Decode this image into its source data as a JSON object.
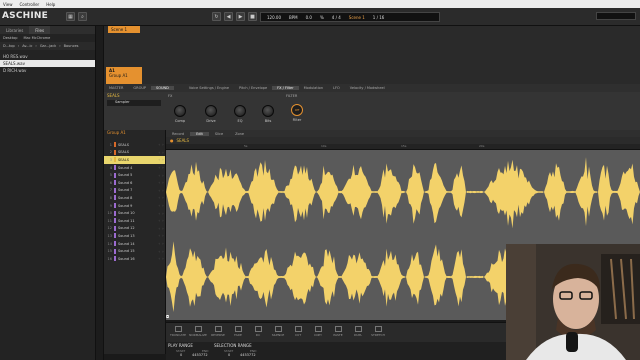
{
  "menubar": [
    "View",
    "Controller",
    "Help"
  ],
  "app_title": "ASCHINE",
  "transport": {
    "tempo": "120.00",
    "tempo_unit": "BPM",
    "swing": "0.0",
    "swing_unit": "%",
    "signature": "4 / 4",
    "scene": "Scene 1",
    "position": "1 / 16"
  },
  "browser": {
    "tabs": [
      "Libraries",
      "Files"
    ],
    "path_shortcuts": [
      "Desktop",
      "Mac McChrome"
    ],
    "path": [
      "D...top",
      "Av...ic",
      "Gar...jack",
      "Bounces"
    ],
    "files": [
      "HO RES.wav",
      "SEALS.wav",
      "D RICH.wav"
    ],
    "selected_index": 1
  },
  "arranger": {
    "scene_label": "Scene 1",
    "group_label": "A1",
    "group_name": "Group A1"
  },
  "plugin": {
    "strip_tabs": [
      "MASTER",
      "GROUP",
      "SOUND"
    ],
    "strip_active": "SOUND",
    "pages": [
      "Voice Settings / Engine",
      "Pitch / Envelope",
      "FX / Filter",
      "Modulation",
      "LFO",
      "Velocity / Modwheel"
    ],
    "active_page": "FX / Filter",
    "sound_name": "SEALS",
    "plugin_name": "Sampler",
    "sections": [
      "FX",
      "FILTER"
    ],
    "knobs": [
      "Comp",
      "Drive",
      "EQ",
      "Bits"
    ],
    "filter_value": "Off",
    "filter_label": "Filter"
  },
  "sounds": {
    "group_name": "Group A1",
    "items": [
      {
        "n": "1",
        "name": "SEALS",
        "color": "#d86a2a"
      },
      {
        "n": "2",
        "name": "SEALS",
        "color": "#d86a2a"
      },
      {
        "n": "3",
        "name": "SEALS",
        "color": "#e5b840"
      },
      {
        "n": "4",
        "name": "Sound 4",
        "color": "#9c6bd0"
      },
      {
        "n": "5",
        "name": "Sound 5",
        "color": "#9c6bd0"
      },
      {
        "n": "6",
        "name": "Sound 6",
        "color": "#9c6bd0"
      },
      {
        "n": "7",
        "name": "Sound 7",
        "color": "#9c6bd0"
      },
      {
        "n": "8",
        "name": "Sound 8",
        "color": "#9c6bd0"
      },
      {
        "n": "9",
        "name": "Sound 9",
        "color": "#9c6bd0"
      },
      {
        "n": "10",
        "name": "Sound 10",
        "color": "#9c6bd0"
      },
      {
        "n": "11",
        "name": "Sound 11",
        "color": "#9c6bd0"
      },
      {
        "n": "12",
        "name": "Sound 12",
        "color": "#9c6bd0"
      },
      {
        "n": "13",
        "name": "Sound 13",
        "color": "#9c6bd0"
      },
      {
        "n": "14",
        "name": "Sound 14",
        "color": "#9c6bd0"
      },
      {
        "n": "15",
        "name": "Sound 15",
        "color": "#9c6bd0"
      },
      {
        "n": "16",
        "name": "Sound 16",
        "color": "#9c6bd0"
      }
    ],
    "selected_index": 2
  },
  "editor": {
    "tabs": [
      "Record",
      "Edit",
      "Slice",
      "Zone"
    ],
    "active_tab": "Edit",
    "sample_name": "SEALS",
    "ruler_marks": [
      "5s",
      "10s",
      "15s",
      "20s"
    ],
    "waveform_color": "#f3d26a"
  },
  "bottom_tools": [
    "TRUNCATE",
    "NORMALIZE",
    "REVERSE",
    "FADE",
    "DC",
    "SILENCE",
    "CUT",
    "COPY",
    "PASTE",
    "DUPL",
    "STRETCH"
  ],
  "ranges": {
    "play_range": "PLAY RANGE",
    "selection_range": "SELECTION RANGE",
    "start_label": "START",
    "end_label": "END",
    "play_start": "0",
    "play_end": "4453772",
    "sel_start": "0",
    "sel_end": "4453772"
  },
  "colors": {
    "accent": "#e5912f",
    "waveform": "#f3d26a",
    "selected_row": "#e9d66d"
  }
}
